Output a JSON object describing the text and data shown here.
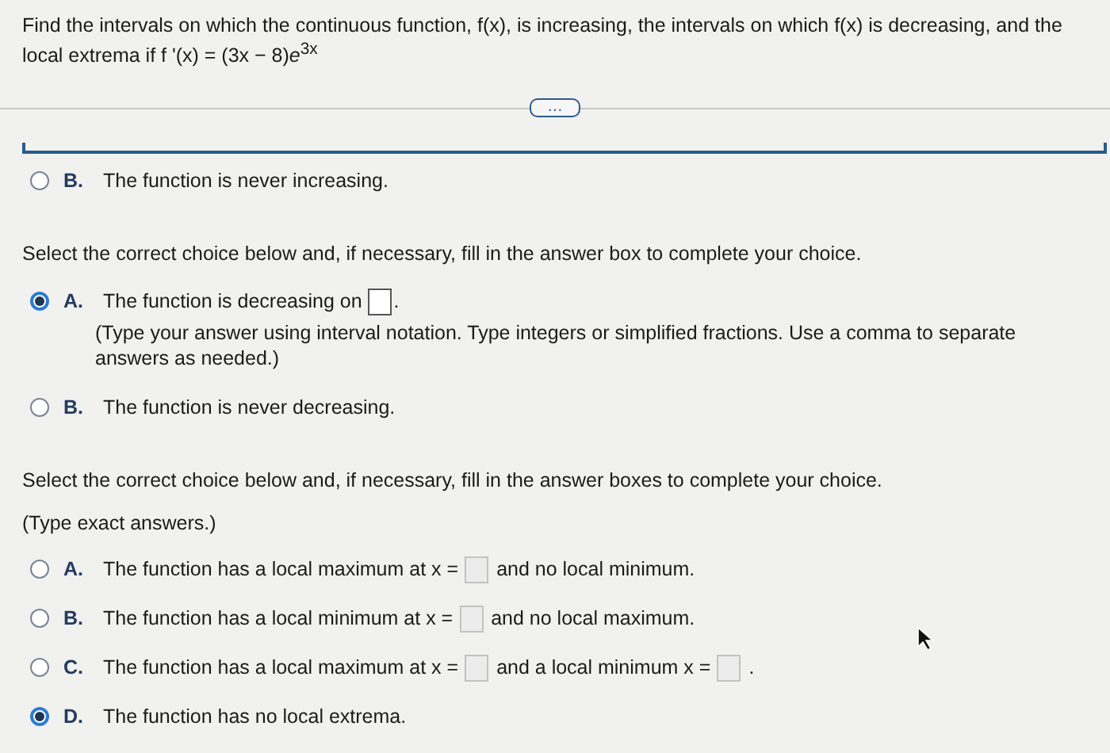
{
  "question": "Find the intervals on which the continuous function, f(x), is increasing, the intervals on which f(x) is decreasing, and the local extrema if f '(x) = (3x − 8)*e*$^{3x}$",
  "more_button": "…",
  "sections": [
    {
      "choices": [
        {
          "letter": "B.",
          "selected": false,
          "segments": [
            {
              "kind": "text",
              "text": "The function is never increasing."
            }
          ]
        }
      ]
    },
    {
      "instruction": "Select the correct choice below and, if necessary, fill in the answer box to complete your choice.",
      "choices": [
        {
          "letter": "A.",
          "selected": true,
          "segments": [
            {
              "kind": "text",
              "text": "The function is decreasing on"
            },
            {
              "kind": "box"
            },
            {
              "kind": "text",
              "text": "."
            }
          ],
          "note": "(Type your answer using interval notation. Type integers or simplified fractions. Use a comma to separate answers as needed.)"
        },
        {
          "letter": "B.",
          "selected": false,
          "segments": [
            {
              "kind": "text",
              "text": "The function is never decreasing."
            }
          ]
        }
      ]
    },
    {
      "instruction": "Select the correct choice below and, if necessary, fill in the answer boxes to complete your choice.",
      "note": "(Type exact answers.)",
      "choices": [
        {
          "letter": "A.",
          "selected": false,
          "segments": [
            {
              "kind": "text",
              "text": "The function has a local maximum at x ="
            },
            {
              "kind": "box"
            },
            {
              "kind": "text",
              "text": "and no local minimum."
            }
          ]
        },
        {
          "letter": "B.",
          "selected": false,
          "segments": [
            {
              "kind": "text",
              "text": "The function has a local minimum at x ="
            },
            {
              "kind": "box"
            },
            {
              "kind": "text",
              "text": "and no local maximum."
            }
          ]
        },
        {
          "letter": "C.",
          "selected": false,
          "segments": [
            {
              "kind": "text",
              "text": "The function has a local maximum at x ="
            },
            {
              "kind": "box"
            },
            {
              "kind": "text",
              "text": "and a local minimum x ="
            },
            {
              "kind": "box"
            },
            {
              "kind": "text",
              "text": "."
            }
          ]
        },
        {
          "letter": "D.",
          "selected": true,
          "segments": [
            {
              "kind": "text",
              "text": "The function has no local extrema."
            }
          ]
        }
      ]
    }
  ]
}
